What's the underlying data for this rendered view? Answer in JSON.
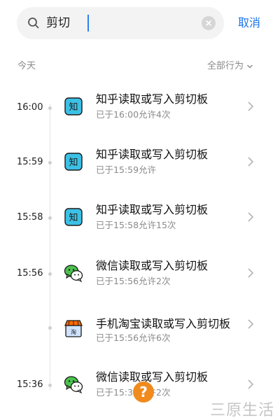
{
  "search": {
    "value": "剪切",
    "cancel_label": "取消"
  },
  "header": {
    "day_label": "今天",
    "filter_label": "全部行为"
  },
  "entries": [
    {
      "time": "16:00",
      "app": "zhihu",
      "title": "知乎读取或写入剪切板",
      "subtitle": "已于16:00允许4次",
      "icon_text": "知"
    },
    {
      "time": "15:59",
      "app": "zhihu",
      "title": "知乎读取或写入剪切板",
      "subtitle": "已于15:59允许",
      "icon_text": "知"
    },
    {
      "time": "15:58",
      "app": "zhihu",
      "title": "知乎读取或写入剪切板",
      "subtitle": "已于15:58允许15次",
      "icon_text": "知"
    },
    {
      "time": "15:56",
      "app": "wechat",
      "title": "微信读取或写入剪切板",
      "subtitle": "已于15:56允许2次",
      "icon_text": ""
    },
    {
      "time": "",
      "app": "taobao",
      "title": "手机淘宝读取或写入剪切板",
      "subtitle": "已于15:56允许6次",
      "icon_text": "淘"
    },
    {
      "time": "15:36",
      "app": "wechat",
      "title": "微信读取或写入剪切板",
      "subtitle": "已于15:36允许2次",
      "icon_text": ""
    }
  ],
  "overlay": {
    "help_badge": "?",
    "watermark": "三原生活"
  },
  "colors": {
    "accent": "#1a73e8",
    "zhihu": "#3cc1e6",
    "wechat": "#4cc24e",
    "taobao_roof": "#ff6a00",
    "badge": "#f08a1c"
  }
}
